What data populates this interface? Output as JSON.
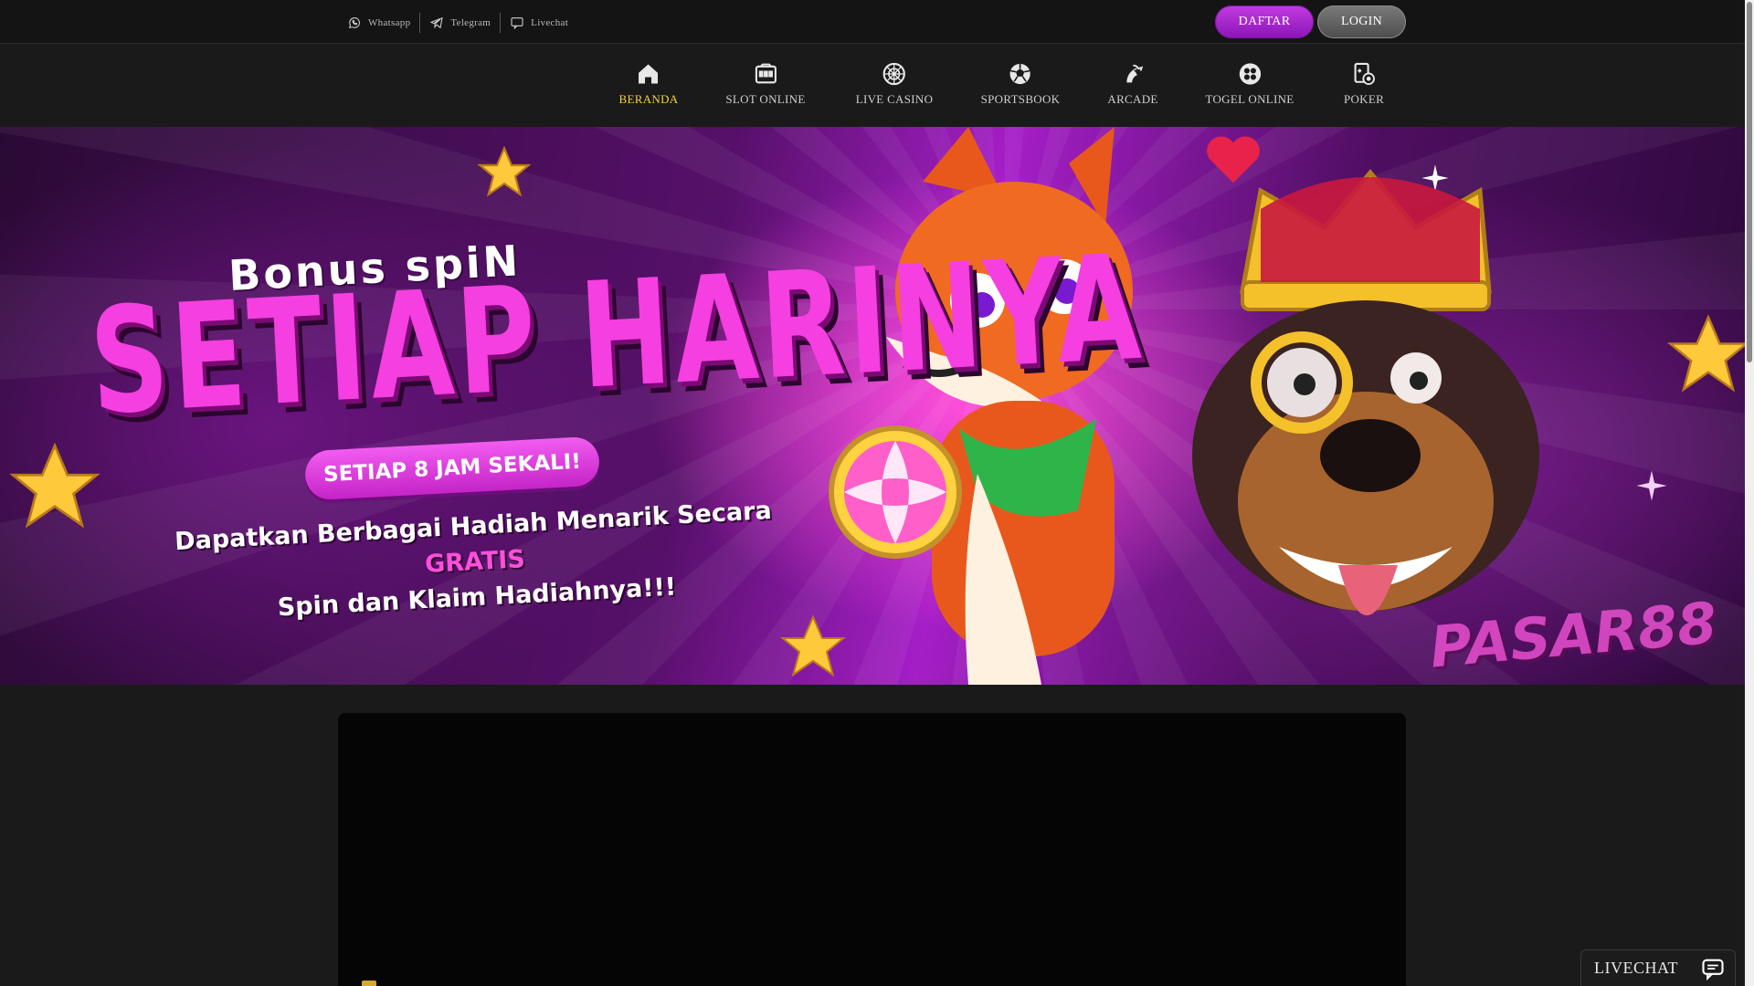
{
  "topbar": {
    "contacts": [
      {
        "label": "Whatsapp",
        "icon": "whatsapp-icon"
      },
      {
        "label": "Telegram",
        "icon": "telegram-icon"
      },
      {
        "label": "Livechat",
        "icon": "chat-bubble-icon"
      }
    ],
    "daftar_label": "DAFTAR",
    "login_label": "LOGIN"
  },
  "nav": {
    "items": [
      {
        "label": "BERANDA",
        "icon": "home-icon",
        "active": true
      },
      {
        "label": "SLOT ONLINE",
        "icon": "slot-machine-icon",
        "active": false
      },
      {
        "label": "LIVE CASINO",
        "icon": "roulette-icon",
        "active": false
      },
      {
        "label": "SPORTSBOOK",
        "icon": "soccer-ball-icon",
        "active": false
      },
      {
        "label": "ARCADE",
        "icon": "fish-icon",
        "active": false
      },
      {
        "label": "TOGEL ONLINE",
        "icon": "lottery-balls-icon",
        "active": false
      },
      {
        "label": "POKER",
        "icon": "poker-cards-icon",
        "active": false
      }
    ],
    "active_color": "#f2d33a"
  },
  "banner": {
    "subtitle": "Bonus spiN",
    "title": "SETIAP HARINYA",
    "pill": "SETIAP 8 JAM SEKALI!",
    "desc_line1_pre": "Dapatkan Berbagai Hadiah Menarik Secara",
    "desc_line1_highlight": "GRATIS",
    "desc_line2": "Spin dan Klaim Hadiahnya!!!",
    "logo": "PASAR88"
  },
  "livechat": {
    "label": "LIVECHAT"
  },
  "colors": {
    "background": "#1a1a1a",
    "brand_purple": "#a51ec7",
    "daftar_button": "#8a15b8",
    "login_button": "#4d4d4d"
  }
}
